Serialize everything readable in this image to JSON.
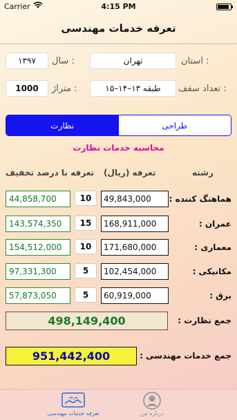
{
  "status_bar": {
    "carrier": "Carrier",
    "time": "4:15 PM",
    "battery_level": 0.9
  },
  "nav": {
    "title": "تعرفه خدمات مهندسی"
  },
  "form": {
    "province": {
      "label": "استان :",
      "value": "تهران"
    },
    "year": {
      "label": "سال :",
      "value": "۱۳۹۷"
    },
    "floors": {
      "label": "تعداد سقف :",
      "value": "۱۵–۱۴–۱۳ طبقه"
    },
    "area": {
      "label": "متراژ :",
      "value": "1000"
    }
  },
  "segmented": {
    "design_label": "طراحی",
    "supervision_label": "نظارت",
    "selected": "supervision"
  },
  "calc_title": "محاسبه خدمات نظارت",
  "table": {
    "headers": {
      "discipline": "رشته",
      "fee": "تعرفه (ریال)",
      "discounted": "تعرفه با درصد تخفیف"
    },
    "rows": [
      {
        "label": "هماهنگ کننده :",
        "amount": "49,843,000",
        "percent": "10",
        "discounted": "44,858,700"
      },
      {
        "label": "عمران :",
        "amount": "168,911,000",
        "percent": "15",
        "discounted": "143,574,350"
      },
      {
        "label": "معماری :",
        "amount": "171,680,000",
        "percent": "10",
        "discounted": "154,512,000"
      },
      {
        "label": "مکانیکی :",
        "amount": "102,454,000",
        "percent": "5",
        "discounted": "97,331,300"
      },
      {
        "label": "برق :",
        "amount": "60,919,000",
        "percent": "5",
        "discounted": "57,873,050"
      }
    ]
  },
  "totals": {
    "supervision_label": "جمع نظارت :",
    "supervision_value": "498,149,400",
    "engineering_label": "جمع خدمات مهندسی :",
    "engineering_value": "951,442,400"
  },
  "tabbar": {
    "calc_label": "تعرفه خدمات مهندسی",
    "calc_icon_text": "تعرفه",
    "about_label": "درباره من",
    "selected": "calc"
  },
  "colors": {
    "accent": "#1414ee",
    "highlight": "#e3089e",
    "discount_green": "#157a2b",
    "total_yellow": "#f5f23c"
  }
}
